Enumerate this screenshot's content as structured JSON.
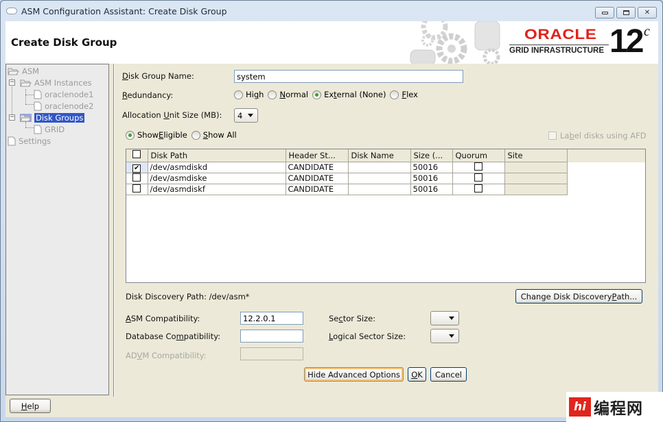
{
  "window": {
    "title": "ASM Configuration Assistant: Create Disk Group",
    "controls": {
      "minimize": "–",
      "maximize": "□",
      "close": "✕"
    }
  },
  "header": {
    "title": "Create Disk Group",
    "brand": {
      "oracle": "ORACLE",
      "product": "GRID INFRASTRUCTURE",
      "version": "12",
      "version_suffix": "c"
    }
  },
  "sidebar": {
    "tree": [
      {
        "label": "ASM",
        "icon": "folder-open-icon",
        "level": 0
      },
      {
        "label": "ASM Instances",
        "icon": "folder-open-icon",
        "level": 1
      },
      {
        "label": "oraclenode1",
        "icon": "document-icon",
        "level": 2
      },
      {
        "label": "oraclenode2",
        "icon": "document-icon",
        "level": 2
      },
      {
        "label": "Disk Groups",
        "icon": "folder-open-icon",
        "level": 1,
        "selected": true
      },
      {
        "label": "GRID",
        "icon": "document-icon",
        "level": 2
      },
      {
        "label": "Settings",
        "icon": "document-icon",
        "level": 0
      }
    ]
  },
  "form": {
    "disk_group_name": {
      "label_pre": "",
      "label_u": "D",
      "label_post": "isk Group Name:",
      "value": "system"
    },
    "redundancy": {
      "label_u": "R",
      "label_post": "edundancy:",
      "options": [
        {
          "pre": "Hi",
          "u": "g",
          "post": "h",
          "selected": false
        },
        {
          "pre": "",
          "u": "N",
          "post": "ormal",
          "selected": false
        },
        {
          "pre": "Ex",
          "u": "t",
          "post": "ernal (None)",
          "selected": true
        },
        {
          "pre": "",
          "u": "F",
          "post": "lex",
          "selected": false
        }
      ]
    },
    "allocation_unit": {
      "label_pre": "Allocation ",
      "label_u": "U",
      "label_post": "nit Size (MB):",
      "value": "4"
    },
    "show_filter": {
      "options": [
        {
          "pre": "Show ",
          "u": "E",
          "post": "ligible",
          "selected": true
        },
        {
          "pre": "",
          "u": "S",
          "post": "how All",
          "selected": false
        }
      ]
    },
    "label_afd": {
      "pre": "La",
      "u": "b",
      "post": "el disks using AFD",
      "checked": false,
      "enabled": false
    }
  },
  "table": {
    "columns": [
      "",
      "Disk Path",
      "Header St...",
      "Disk Name",
      "Size (...",
      "Quorum",
      "Site"
    ],
    "rows": [
      {
        "selected": true,
        "disk_path": "/dev/asmdiskd",
        "header_status": "CANDIDATE",
        "disk_name": "",
        "size": "50016",
        "quorum": false,
        "site": ""
      },
      {
        "selected": false,
        "disk_path": "/dev/asmdiske",
        "header_status": "CANDIDATE",
        "disk_name": "",
        "size": "50016",
        "quorum": false,
        "site": ""
      },
      {
        "selected": false,
        "disk_path": "/dev/asmdiskf",
        "header_status": "CANDIDATE",
        "disk_name": "",
        "size": "50016",
        "quorum": false,
        "site": ""
      }
    ]
  },
  "discovery": {
    "label": "Disk Discovery Path:",
    "value": "/dev/asm*",
    "change_button": {
      "pre": "Change Disk Discovery ",
      "u": "P",
      "post": "ath..."
    }
  },
  "advanced": {
    "asm_compat": {
      "label_u": "A",
      "label_post": "SM Compatibility:",
      "value": "12.2.0.1"
    },
    "db_compat": {
      "label_pre": "Database Co",
      "label_u": "m",
      "label_post": "patibility:",
      "value": ""
    },
    "advm_compat": {
      "label_pre": "AD",
      "label_u": "V",
      "label_post": "M Compatibility:",
      "value": "",
      "enabled": false
    },
    "sector_size": {
      "label_pre": "Se",
      "label_u": "c",
      "label_post": "tor Size:",
      "value": ""
    },
    "logical_sector_size": {
      "label_u": "L",
      "label_post": "ogical Sector Size:",
      "value": ""
    }
  },
  "buttons": {
    "hide_advanced": "Hide Advanced Options",
    "ok": {
      "u": "O",
      "post": "K"
    },
    "cancel": "Cancel",
    "help": {
      "u": "H",
      "post": "elp"
    }
  },
  "watermark": {
    "logo": "hi",
    "text": "编程网"
  }
}
